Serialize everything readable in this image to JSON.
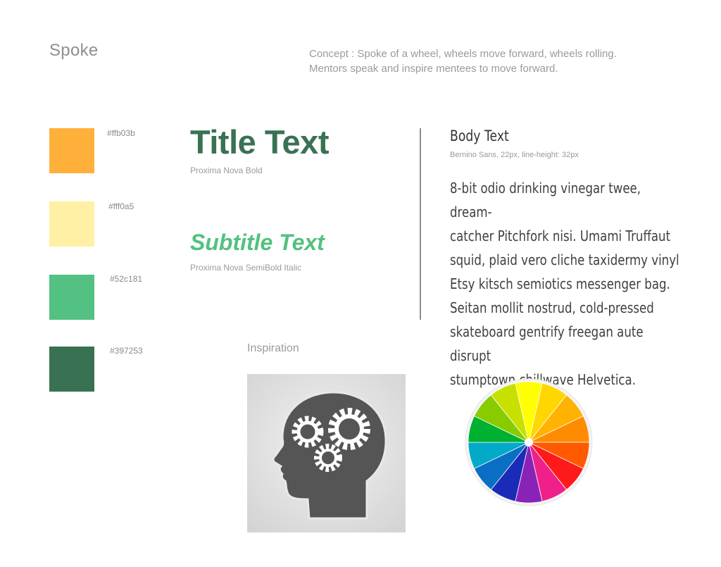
{
  "brand": {
    "name": "Spoke"
  },
  "concept": {
    "line1": "Concept : Spoke of a wheel, wheels move forward, wheels rolling.",
    "line2": "Mentors speak and inspire mentees to move forward."
  },
  "palette": [
    {
      "hex_label": "#ffb03b",
      "color": "#ffb03b"
    },
    {
      "hex_label": "#fff0a5",
      "color": "#fff0a5"
    },
    {
      "hex_label": "#52c181",
      "color": "#52c181"
    },
    {
      "hex_label": "#397253",
      "color": "#397253"
    }
  ],
  "typography": {
    "title": {
      "sample": "Title Text",
      "font_note": "Proxima Nova Bold"
    },
    "subtitle": {
      "sample": "Subtitle Text",
      "font_note": "Proxima Nova SemiBold Italic"
    },
    "body": {
      "heading": "Body Text",
      "font_note": "Bernino Sans, 22px, line-height: 32px",
      "lines": [
        "8-bit odio drinking vinegar twee, dream-",
        "catcher Pitchfork nisi. Umami Truffaut",
        "squid, plaid vero cliche taxidermy vinyl",
        "Etsy kitsch semiotics messenger bag.",
        "Seitan mollit nostrud, cold-pressed",
        "skateboard gentrify freegan aute disrupt",
        "stumptown chillwave Helvetica."
      ]
    }
  },
  "inspiration": {
    "label": "Inspiration",
    "images": [
      {
        "icon": "head-with-gears-icon"
      },
      {
        "icon": "color-wheel-icon"
      }
    ],
    "wheel_colors": [
      "#ffff00",
      "#ffd700",
      "#ffb300",
      "#ff8c00",
      "#ff5a00",
      "#ff1a1a",
      "#f0208a",
      "#8b22b8",
      "#1a2bb8",
      "#0a6fc4",
      "#00aac8",
      "#00b030",
      "#88cc00",
      "#c8e000"
    ]
  }
}
